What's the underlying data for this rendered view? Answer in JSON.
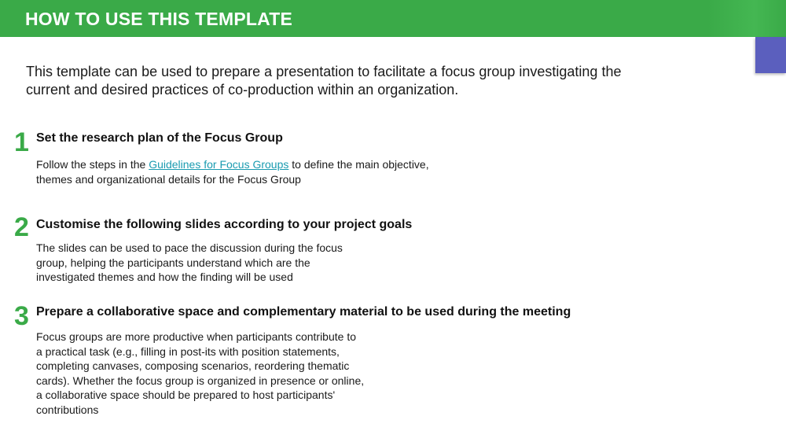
{
  "header": {
    "title": "HOW TO USE THIS TEMPLATE"
  },
  "intro": {
    "line1": "This template can be used to prepare a presentation to facilitate a focus group investigating the",
    "line2": "current and desired practices of co-production within an organization."
  },
  "steps": [
    {
      "number": "1",
      "title": "Set the research plan of the Focus Group",
      "body_pre": "Follow the steps in the ",
      "link_text": "Guidelines for Focus Groups",
      "body_post": " to define the main objective,",
      "body_line2": "themes and organizational details for the Focus Group"
    },
    {
      "number": "2",
      "title": "Customise the following slides according to your project goals",
      "lines": [
        "The slides can be used to pace the discussion during the focus",
        "group, helping the participants understand which are the",
        "investigated themes and how the finding will be used"
      ]
    },
    {
      "number": "3",
      "title": "Prepare a collaborative space and complementary material  to be used during the meeting",
      "lines": [
        "Focus groups are more productive when participants contribute to",
        "a practical task (e.g., filling in post-its with position statements,",
        "completing canvases, composing scenarios, reordering thematic",
        "cards). Whether the focus group is organized in presence or online,",
        "a collaborative space should be prepared to host participants'",
        "contributions"
      ]
    }
  ],
  "colors": {
    "header_green": "#3aaa48",
    "step_number_green": "#3aaa48",
    "corner_tab_purple": "#5b5fbe",
    "link": "#1a9bb0"
  }
}
